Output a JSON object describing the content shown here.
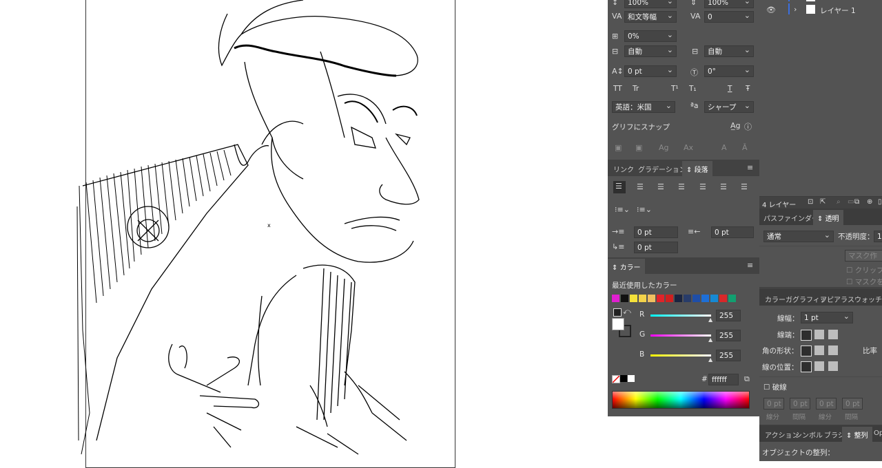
{
  "character": {
    "leading": "100%",
    "tracking_scale": "100%",
    "kerning": "和文等幅",
    "tracking": "0",
    "tsume": "0%",
    "mojikumi_left": "自動",
    "mojikumi_right": "自動",
    "baseline": "0 pt",
    "rotation": "0°",
    "tt_label": "TT",
    "tr_label": "Tr",
    "sup_label": "T¹",
    "sub_label": "T₁",
    "under_label": "T",
    "strike_label": "Ŧ",
    "language": "英語：米国",
    "aa_label": "ªa",
    "antialias": "シャープ",
    "snap_label": "グリフにスナップ"
  },
  "paragraph_tabs": [
    "リンク",
    "グラデーション",
    "段落"
  ],
  "paragraph": {
    "left_indent": "0 pt",
    "right_indent": "0 pt",
    "first_indent": "0 pt"
  },
  "color": {
    "tab": "カラー",
    "recent_label": "最近使用したカラー",
    "r_label": "R",
    "g_label": "G",
    "b_label": "B",
    "r": "255",
    "g": "255",
    "b": "255",
    "hex_prefix": "#",
    "hex": "ffffff",
    "swatches": [
      "#e01fd0",
      "#111111",
      "#f5e23a",
      "#f3d34a",
      "#f0c060",
      "#e0232a",
      "#cf2020",
      "#1a2440",
      "#283c6a",
      "#1f4ea8",
      "#1e6fd6",
      "#1689d4",
      "#d8282a",
      "#12a070"
    ]
  },
  "layers": {
    "layer_name": "レイヤー 1",
    "count": "4 レイヤー"
  },
  "transparency": {
    "tabs": [
      "パスファインダー",
      "透明"
    ],
    "mode": "通常",
    "opacity_label": "不透明度：",
    "opacity_value": "10",
    "mask_btn": "マスク作",
    "clip_label": "クリップ",
    "invert_label": "マスクを"
  },
  "stroke": {
    "tabs": [
      "カラーガ",
      "グラフィッ",
      "アピアラ",
      "スウォッチ"
    ],
    "weight_label": "線幅：",
    "weight": "1 pt",
    "cap_label": "線端：",
    "corner_label": "角の形状：",
    "ratio_label": "比率",
    "align_label": "線の位置：",
    "dash_label": "破線",
    "dash_fields": [
      "0 pt",
      "0 pt",
      "0 pt",
      "0 pt"
    ],
    "dash_sub": [
      "線分",
      "間隔",
      "線分",
      "間隔"
    ]
  },
  "align": {
    "tabs": [
      "アクション",
      "シンボル",
      "ブラシ",
      "整列",
      "Op"
    ],
    "title": "オブジェクトの整列："
  }
}
